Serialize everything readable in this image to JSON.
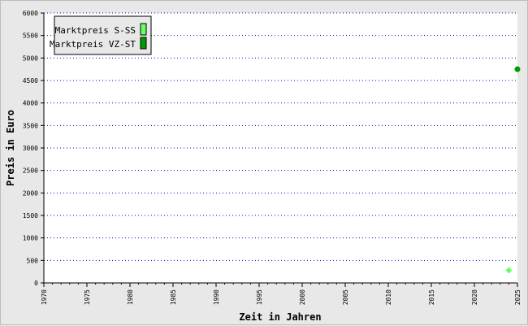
{
  "chart_data": {
    "type": "scatter",
    "xlabel": "Zeit in Jahren",
    "ylabel": "Preis in Euro",
    "xlim": [
      1970,
      2025
    ],
    "ylim": [
      0,
      6000
    ],
    "x_ticks_labeled": [
      1970,
      1975,
      1980,
      1985,
      1990,
      1995,
      2000,
      2005,
      2010,
      2015,
      2020,
      2025
    ],
    "y_ticks": [
      0,
      500,
      1000,
      1500,
      2000,
      2500,
      3000,
      3500,
      4000,
      4500,
      5000,
      5500,
      6000
    ],
    "grid": "horizontal dotted",
    "legend_position": "top-left",
    "series": [
      {
        "name": "Marktpreis S-SS",
        "color": "#66ff66",
        "marker": "diamond",
        "points": [
          {
            "x": 2024,
            "y": 280
          }
        ]
      },
      {
        "name": "Marktpreis VZ-ST",
        "color": "#009900",
        "marker": "circle",
        "points": [
          {
            "x": 2025,
            "y": 4750
          }
        ]
      }
    ]
  }
}
